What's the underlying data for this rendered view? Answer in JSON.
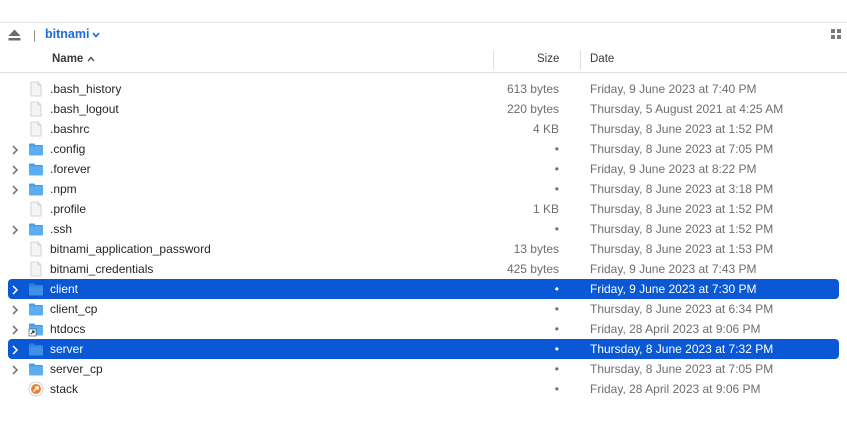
{
  "path": {
    "crumb": "bitnami"
  },
  "columns": {
    "name": "Name",
    "size": "Size",
    "date": "Date"
  },
  "colors": {
    "selection": "#0a58d6",
    "link": "#1a6be0",
    "folder": "#5aaef0"
  },
  "files": [
    {
      "name": ".bash_history",
      "size": "613 bytes",
      "date": "Friday, 9 June 2023 at 7:40 PM",
      "kind": "file",
      "expandable": false,
      "selected": false
    },
    {
      "name": ".bash_logout",
      "size": "220 bytes",
      "date": "Thursday, 5 August 2021 at 4:25 AM",
      "kind": "file",
      "expandable": false,
      "selected": false
    },
    {
      "name": ".bashrc",
      "size": "4 KB",
      "date": "Thursday, 8 June 2023 at 1:52 PM",
      "kind": "file",
      "expandable": false,
      "selected": false
    },
    {
      "name": ".config",
      "size": "•",
      "date": "Thursday, 8 June 2023 at 7:05 PM",
      "kind": "folder",
      "expandable": true,
      "selected": false
    },
    {
      "name": ".forever",
      "size": "•",
      "date": "Friday, 9 June 2023 at 8:22 PM",
      "kind": "folder",
      "expandable": true,
      "selected": false
    },
    {
      "name": ".npm",
      "size": "•",
      "date": "Thursday, 8 June 2023 at 3:18 PM",
      "kind": "folder",
      "expandable": true,
      "selected": false
    },
    {
      "name": ".profile",
      "size": "1 KB",
      "date": "Thursday, 8 June 2023 at 1:52 PM",
      "kind": "file",
      "expandable": false,
      "selected": false
    },
    {
      "name": ".ssh",
      "size": "•",
      "date": "Thursday, 8 June 2023 at 1:52 PM",
      "kind": "folder",
      "expandable": true,
      "selected": false
    },
    {
      "name": "bitnami_application_password",
      "size": "13 bytes",
      "date": "Thursday, 8 June 2023 at 1:53 PM",
      "kind": "file",
      "expandable": false,
      "selected": false
    },
    {
      "name": "bitnami_credentials",
      "size": "425 bytes",
      "date": "Friday, 9 June 2023 at 7:43 PM",
      "kind": "file",
      "expandable": false,
      "selected": false
    },
    {
      "name": "client",
      "size": "•",
      "date": "Friday, 9 June 2023 at 7:30 PM",
      "kind": "folder",
      "expandable": true,
      "selected": true
    },
    {
      "name": "client_cp",
      "size": "•",
      "date": "Thursday, 8 June 2023 at 6:34 PM",
      "kind": "folder",
      "expandable": true,
      "selected": false
    },
    {
      "name": "htdocs",
      "size": "•",
      "date": "Friday, 28 April 2023 at 9:06 PM",
      "kind": "alias-folder",
      "expandable": true,
      "selected": false
    },
    {
      "name": "server",
      "size": "•",
      "date": "Thursday, 8 June 2023 at 7:32 PM",
      "kind": "folder",
      "expandable": true,
      "selected": true
    },
    {
      "name": "server_cp",
      "size": "•",
      "date": "Thursday, 8 June 2023 at 7:05 PM",
      "kind": "folder",
      "expandable": true,
      "selected": false
    },
    {
      "name": "stack",
      "size": "•",
      "date": "Friday, 28 April 2023 at 9:06 PM",
      "kind": "alias",
      "expandable": false,
      "selected": false
    }
  ]
}
